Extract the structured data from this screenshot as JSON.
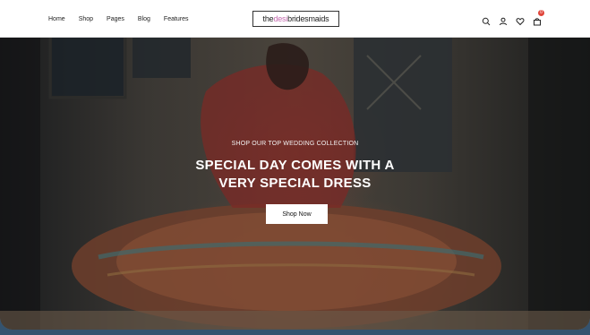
{
  "nav": {
    "items": [
      "Home",
      "Shop",
      "Pages",
      "Blog",
      "Features"
    ]
  },
  "logo": {
    "part1": "the",
    "part2": "desi",
    "part3": "bridesmaids"
  },
  "icons": [
    "search-icon",
    "user-icon",
    "heart-icon",
    "cart-icon"
  ],
  "cart": {
    "count": "0"
  },
  "hero": {
    "eyebrow": "SHOP OUR TOP WEDDING COLLECTION",
    "headline_line1": "SPECIAL DAY COMES WITH A",
    "headline_line2": "VERY SPECIAL DRESS",
    "cta_label": "Shop Now"
  },
  "colors": {
    "accent": "#c56bb0",
    "badge": "#e0453a",
    "frame": "#34536f"
  }
}
